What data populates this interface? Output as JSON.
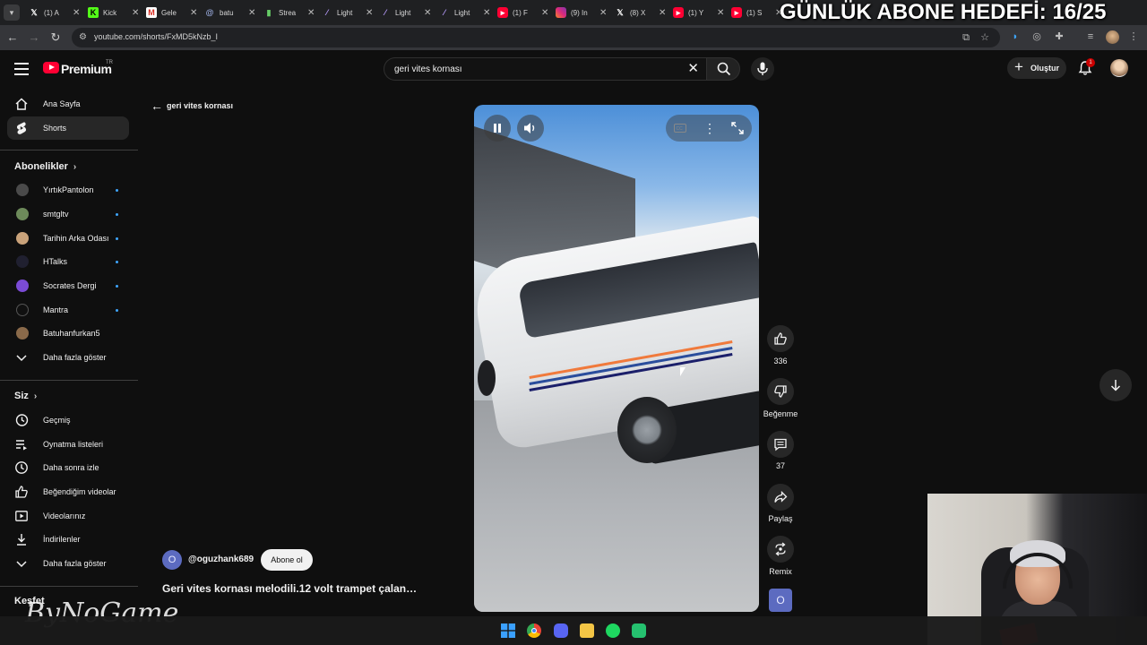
{
  "browser": {
    "tabs": [
      {
        "title": "(1) A",
        "icon": "x-logo-icon"
      },
      {
        "title": "Kick",
        "icon": "kick-icon"
      },
      {
        "title": "Gele",
        "icon": "gmail-icon"
      },
      {
        "title": "batu",
        "icon": "threads-icon"
      },
      {
        "title": "Strea",
        "icon": "streamlabs-icon"
      },
      {
        "title": "Light",
        "icon": "feather-icon"
      },
      {
        "title": "Light",
        "icon": "feather-icon"
      },
      {
        "title": "Light",
        "icon": "feather-icon"
      },
      {
        "title": "(1) F",
        "icon": "youtube-icon"
      },
      {
        "title": "(9) In",
        "icon": "instagram-icon"
      },
      {
        "title": "(8) X",
        "icon": "x-logo-icon"
      },
      {
        "title": "(1) Y",
        "icon": "youtube-icon"
      },
      {
        "title": "(1) S",
        "icon": "youtube-icon"
      }
    ],
    "url": "youtube.com/shorts/FxMD5kNzb_I"
  },
  "stream_overlay": {
    "goal_text": "GÜNLÜK ABONE HEDEFİ: 16/25",
    "watermark": "ByNoGame"
  },
  "masthead": {
    "logo_text": "Premium",
    "country_code": "TR",
    "search_query": "geri vites kornası",
    "create_label": "Oluştur",
    "notification_count": "1"
  },
  "sidebar": {
    "main": [
      {
        "label": "Ana Sayfa",
        "icon": "home-icon"
      },
      {
        "label": "Shorts",
        "icon": "shorts-icon",
        "active": true
      }
    ],
    "subscriptions_title": "Abonelikler",
    "subscriptions": [
      {
        "label": "YırtıkPantolon",
        "avatar_color": "#4a4a4a"
      },
      {
        "label": "smtgltv",
        "avatar_color": "#6d8a5a"
      },
      {
        "label": "Tarihin Arka Odası",
        "avatar_color": "#c9a27a"
      },
      {
        "label": "HTalks",
        "avatar_color": "#202030"
      },
      {
        "label": "Socrates Dergi",
        "avatar_color": "#7b4bd6"
      },
      {
        "label": "Mantra",
        "avatar_color": "#101010"
      },
      {
        "label": "Batuhanfurkan5",
        "avatar_color": "#8a6a4a"
      }
    ],
    "show_more_subs": "Daha fazla göster",
    "you_title": "Siz",
    "you_items": [
      {
        "label": "Geçmiş",
        "icon": "history-icon"
      },
      {
        "label": "Oynatma listeleri",
        "icon": "playlists-icon"
      },
      {
        "label": "Daha sonra izle",
        "icon": "watch-later-icon"
      },
      {
        "label": "Beğendiğim videolar",
        "icon": "like-icon"
      },
      {
        "label": "Videolarınız",
        "icon": "your-videos-icon"
      },
      {
        "label": "İndirilenler",
        "icon": "download-icon"
      }
    ],
    "show_more_you": "Daha fazla göster",
    "explore_title": "Keşfet"
  },
  "content": {
    "back_label": "geri vites kornası",
    "channel_initial": "O",
    "channel_handle": "@oguzhank689",
    "subscribe_label": "Abone ol",
    "title": "Geri vites kornası melodili.12 volt trampet çalan…"
  },
  "actions": {
    "likes": "336",
    "dislike_label": "Beğenme",
    "comments": "37",
    "share_label": "Paylaş",
    "remix_label": "Remix",
    "remix_initial": "O"
  },
  "colors": {
    "accent_red": "#ff0033",
    "subscription_dot": "#3ea6ff",
    "background": "#0f0f0f"
  }
}
